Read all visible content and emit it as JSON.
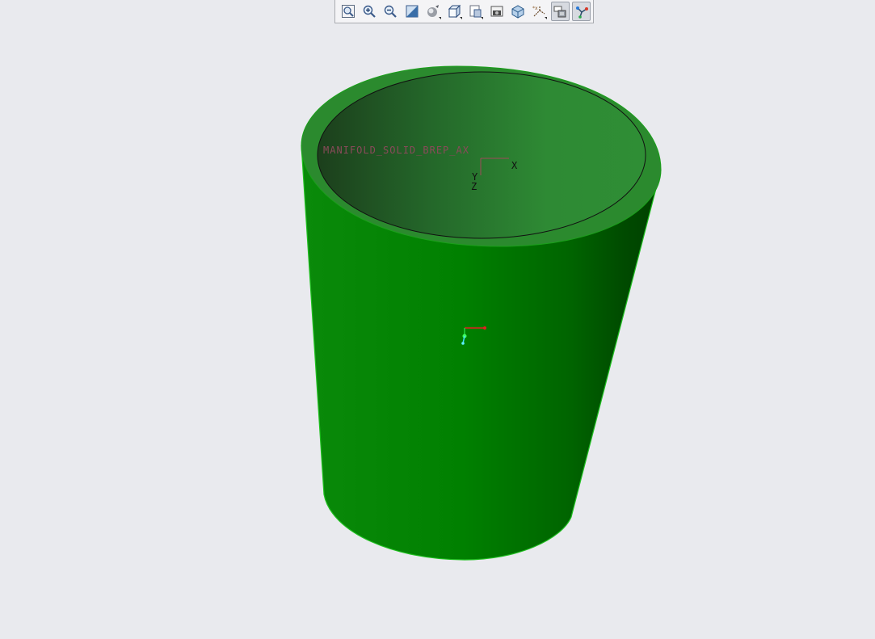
{
  "toolbar": {
    "buttons": [
      {
        "name": "refit-icon",
        "active": false
      },
      {
        "name": "zoom-in-icon",
        "active": false
      },
      {
        "name": "zoom-out-icon",
        "active": false
      },
      {
        "name": "repaint-icon",
        "active": false
      },
      {
        "name": "display-style-icon",
        "active": false,
        "dropdown": true
      },
      {
        "name": "saved-orientations-icon",
        "active": false,
        "dropdown": true
      },
      {
        "name": "view-manager-icon",
        "active": false,
        "dropdown": true
      },
      {
        "name": "snapshot-icon",
        "active": false
      },
      {
        "name": "perspective-view-icon",
        "active": false
      },
      {
        "name": "datum-display-filters-icon",
        "active": false,
        "dropdown": true
      },
      {
        "name": "annotation-display-icon",
        "active": true
      },
      {
        "name": "spin-center-icon",
        "active": true
      }
    ]
  },
  "model": {
    "csys_label": "MANIFOLD_SOLID_BREP_AX",
    "axis_x": "X",
    "axis_y": "Y",
    "axis_z": "Z",
    "colors": {
      "outer_light": "#0a8a0a",
      "outer_dark": "#004a00",
      "inner_dark": "#1e4a1e",
      "inner_light": "#2f8f33",
      "rim": "#2a8a2a",
      "csys_label": "#8a4a5a",
      "background": "#e9eaee"
    }
  }
}
